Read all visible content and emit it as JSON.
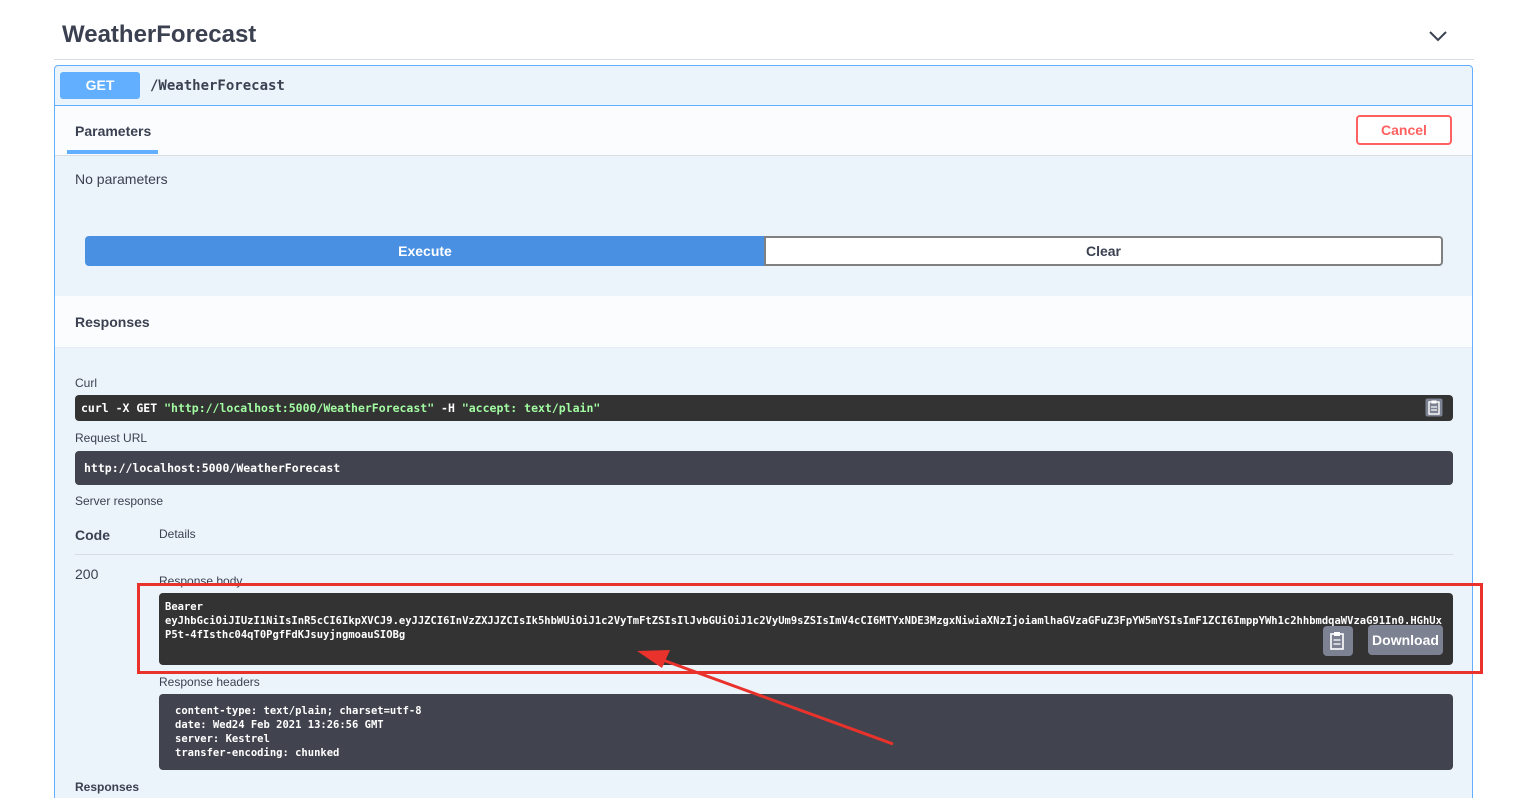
{
  "section": {
    "title": "WeatherForecast",
    "collapse_icon": "chevron-down-icon"
  },
  "operation": {
    "method": "GET",
    "path": "/WeatherForecast"
  },
  "parameters": {
    "tab_label": "Parameters",
    "cancel_label": "Cancel",
    "empty_text": "No parameters"
  },
  "actions": {
    "execute_label": "Execute",
    "clear_label": "Clear"
  },
  "responses": {
    "title": "Responses",
    "curl_label": "Curl",
    "curl_cmd_prefix": "curl -X GET ",
    "curl_url": "\"http://localhost:5000/WeatherForecast\"",
    "curl_flag": " -H  ",
    "curl_header": "\"accept: text/plain\"",
    "request_url_label": "Request URL",
    "request_url": "http://localhost:5000/WeatherForecast",
    "server_response_label": "Server response",
    "code_header": "Code",
    "details_header": "Details",
    "code": "200",
    "body_label": "Response body",
    "body_line1": "Bearer",
    "body_token": "eyJhbGciOiJIUzI1NiIsInR5cCI6IkpXVCJ9.eyJJZCI6InVzZXJJZCIsIk5hbWUiOiJ1c2VyTmFtZSIsIlJvbGUiOiJ1c2VyUm9sZSIsImV4cCI6MTYxNDE3MzgxNiwiaXNzIjoiamlhaGVzaGFuZ3FpYW5mYSIsImF1ZCI6ImppYWh1c2hhbmdqaWVzaG91In0.HGhUxP5t-4fIsthc04qT0PgfFdKJsuyjngmoauSIOBg",
    "download_label": "Download",
    "headers_label": "Response headers",
    "headers": [
      "content-type: text/plain; charset=utf-8",
      "date: Wed24 Feb 2021 13:26:56 GMT",
      "server: Kestrel",
      "transfer-encoding: chunked"
    ],
    "responses_bottom_label": "Responses"
  },
  "colors": {
    "get_accent": "#61affe",
    "execute": "#4990e2",
    "cancel": "#ff6060",
    "annotation": "#e8322b"
  }
}
